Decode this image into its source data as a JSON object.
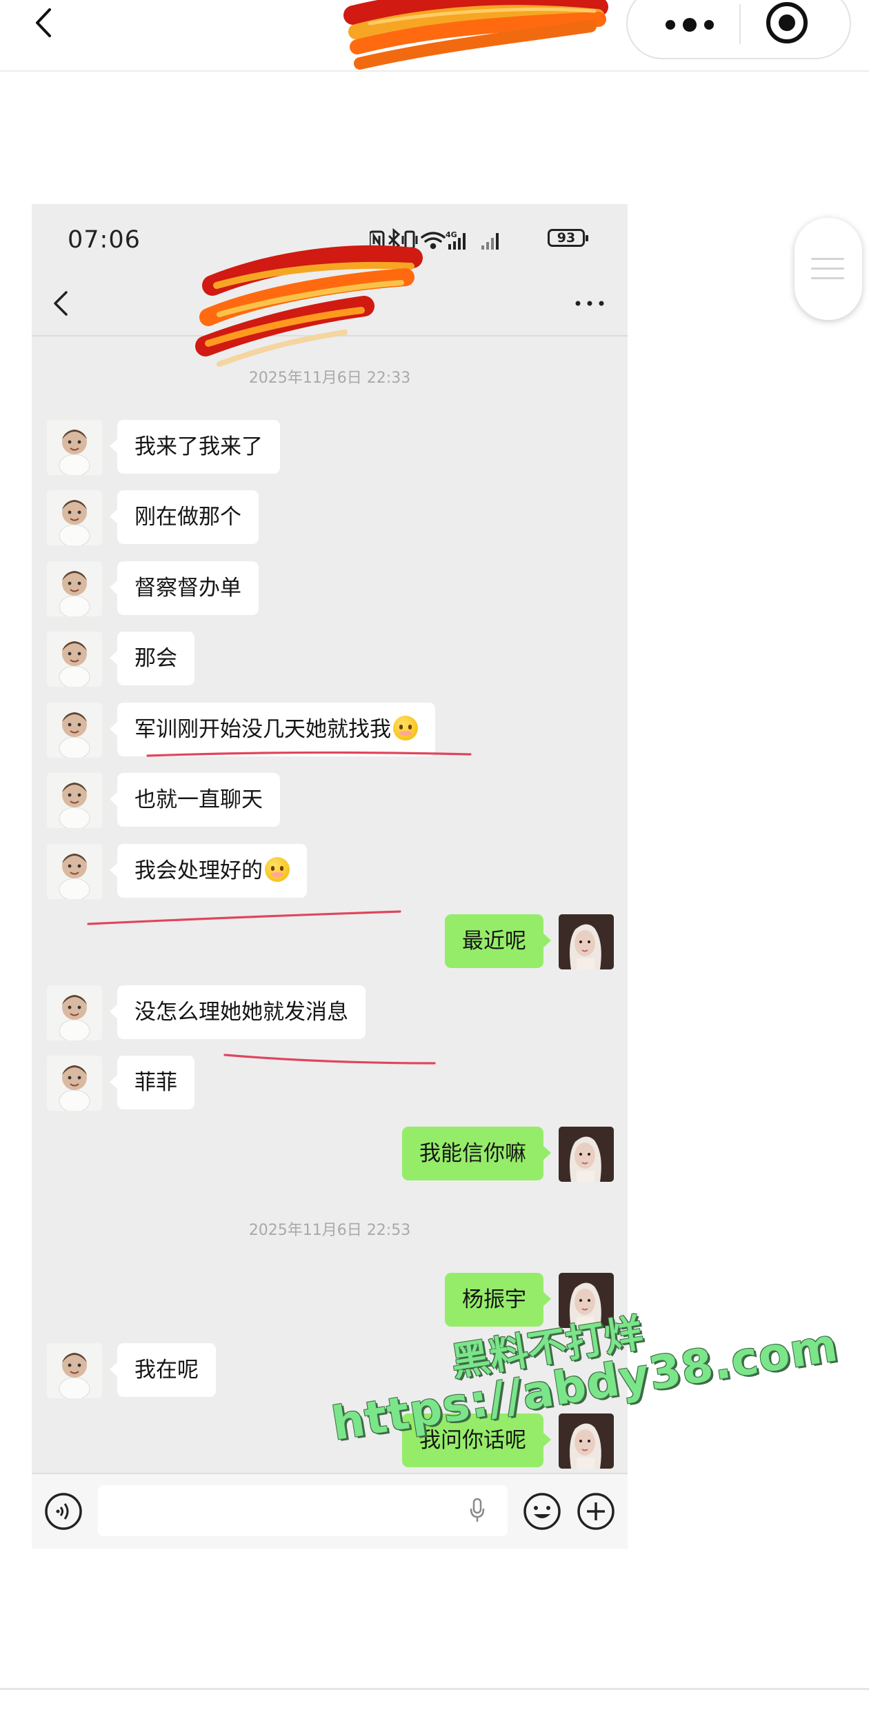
{
  "phone": {
    "time": "07:06",
    "battery": "93",
    "status_icons": [
      "nfc-icon",
      "bluetooth-icon",
      "vibrate-icon",
      "wifi-icon",
      "signal-4g-icon",
      "signal-icon",
      "battery-icon"
    ]
  },
  "messages": [
    {
      "type": "timestamp",
      "text": "2025年11月6日 22:33"
    },
    {
      "type": "in",
      "text": "我来了我来了"
    },
    {
      "type": "in",
      "text": "刚在做那个"
    },
    {
      "type": "in",
      "text": "督察督办单"
    },
    {
      "type": "in",
      "text": "那会"
    },
    {
      "type": "in",
      "text": "军训刚开始没几天她就找我",
      "emoji": "flushed-emoji"
    },
    {
      "type": "in",
      "text": "也就一直聊天"
    },
    {
      "type": "in",
      "text": "我会处理好的",
      "emoji": "flushed-emoji"
    },
    {
      "type": "out",
      "text": "最近呢"
    },
    {
      "type": "in",
      "text": "没怎么理她她就发消息"
    },
    {
      "type": "in",
      "text": "菲菲"
    },
    {
      "type": "out",
      "text": "我能信你嘛"
    },
    {
      "type": "timestamp",
      "text": "2025年11月6日 22:53"
    },
    {
      "type": "out",
      "text": "杨振宇"
    },
    {
      "type": "in",
      "text": "我在呢"
    },
    {
      "type": "out",
      "text": "我问你话呢"
    }
  ],
  "watermark": {
    "line1": "黑料不打烊",
    "line2": "https://abdy38.com"
  },
  "colors": {
    "chat_background": "#ededed",
    "incoming_bubble": "#ffffff",
    "outgoing_bubble": "#95ec69",
    "annotation_underline": "#e0455e",
    "watermark": "#7be58a"
  }
}
